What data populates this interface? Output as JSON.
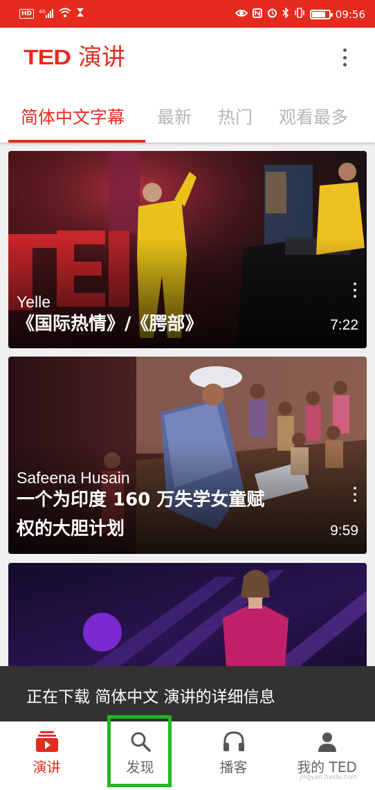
{
  "status_bar": {
    "left_icons": [
      "hd-icon",
      "signal-4g-icon",
      "wifi-icon",
      "hourglass-icon"
    ],
    "hd_label": "HD",
    "signal_label": "4G",
    "right_icons": [
      "eye-icon",
      "nfc-icon",
      "alarm-icon",
      "bluetooth-icon",
      "vibrate-icon",
      "battery-icon"
    ],
    "battery_level": 0.8,
    "time": "09:56"
  },
  "app_bar": {
    "logo_text": "TED",
    "title": "演讲",
    "menu_icon": "more-vert-icon"
  },
  "tabs": [
    {
      "label": "简体中文字幕",
      "active": true
    },
    {
      "label": "最新",
      "active": false
    },
    {
      "label": "热门",
      "active": false
    },
    {
      "label": "观看最多",
      "active": false
    }
  ],
  "talks": [
    {
      "speaker": "Yelle",
      "title": "《国际热情》/《腭部》",
      "duration": "7:22"
    },
    {
      "speaker": "Safeena Husain",
      "title": "一个为印度 160 万失学女童赋权的大胆计划",
      "duration": "9:59"
    },
    {
      "speaker": "",
      "title": "",
      "duration": ""
    }
  ],
  "snackbar": {
    "message": "正在下载 简体中文 演讲的详细信息"
  },
  "bottom_nav": [
    {
      "label": "演讲",
      "icon": "talks-icon",
      "active": true
    },
    {
      "label": "发现",
      "icon": "search-icon",
      "active": false
    },
    {
      "label": "播客",
      "icon": "headphones-icon",
      "active": false
    },
    {
      "label": "我的 TED",
      "icon": "profile-icon",
      "active": false
    }
  ],
  "colors": {
    "accent": "#e62b1e",
    "highlight_box": "#22b622",
    "snackbar": "#323232"
  },
  "watermark": "jingyan.baidu.com"
}
